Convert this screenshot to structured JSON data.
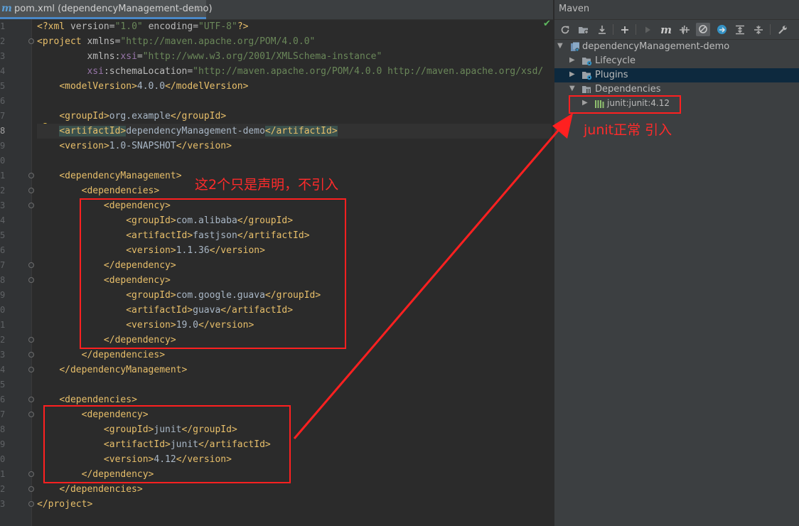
{
  "editor": {
    "tab_title": "pom.xml (dependencyManagement-demo)",
    "tab_close": "×",
    "line_numbers": [
      "1",
      "2",
      "3",
      "4",
      "5",
      "6",
      "7",
      "8",
      "9",
      "0",
      "1",
      "2",
      "3",
      "4",
      "5",
      "6",
      "7",
      "8",
      "9",
      "0",
      "1",
      "2",
      "3",
      "4",
      "5",
      "6",
      "7",
      "8",
      "9",
      "0",
      "1",
      "2",
      "3"
    ],
    "lines": [
      "<?xml version=\"1.0\" encoding=\"UTF-8\"?>",
      "<project xmlns=\"http://maven.apache.org/POM/4.0.0\"",
      "         xmlns:xsi=\"http://www.w3.org/2001/XMLSchema-instance\"",
      "         xsi:schemaLocation=\"http://maven.apache.org/POM/4.0.0 http://maven.apache.org/xsd/",
      "    <modelVersion>4.0.0</modelVersion>",
      "",
      "    <groupId>org.example</groupId>",
      "    <artifactId>dependencyManagement-demo</artifactId>",
      "    <version>1.0-SNAPSHOT</version>",
      "",
      "    <dependencyManagement>",
      "        <dependencies>",
      "            <dependency>",
      "                <groupId>com.alibaba</groupId>",
      "                <artifactId>fastjson</artifactId>",
      "                <version>1.1.36</version>",
      "            </dependency>",
      "            <dependency>",
      "                <groupId>com.google.guava</groupId>",
      "                <artifactId>guava</artifactId>",
      "                <version>19.0</version>",
      "            </dependency>",
      "        </dependencies>",
      "    </dependencyManagement>",
      "",
      "    <dependencies>",
      "        <dependency>",
      "            <groupId>junit</groupId>",
      "            <artifactId>junit</artifactId>",
      "            <version>4.12</version>",
      "        </dependency>",
      "    </dependencies>",
      "</project>"
    ]
  },
  "maven": {
    "title": "Maven",
    "toolbar_icons": [
      "reload-icon",
      "add-folder-icon",
      "download-icon",
      "plus-icon",
      "run-icon",
      "maven-goal-icon",
      "toggle-offline-icon",
      "skip-tests-icon",
      "show-dependencies-icon",
      "expand-all-icon",
      "collapse-all-icon",
      "settings-wrench-icon"
    ],
    "tree": {
      "root": "dependencyManagement-demo",
      "lifecycle": "Lifecycle",
      "plugins": "Plugins",
      "dependencies": "Dependencies",
      "junit": "junit:junit:4.12"
    }
  },
  "annotations": {
    "declaration_note": "这2个只是声明，不引入",
    "junit_note": "junit正常 引入"
  },
  "colors": {
    "editor_bg": "#2b2b2b",
    "panel_bg": "#3c3f41",
    "annotation_red": "#ff2020",
    "xml_tag": "#e8bf6a",
    "xml_string": "#6a8759"
  }
}
